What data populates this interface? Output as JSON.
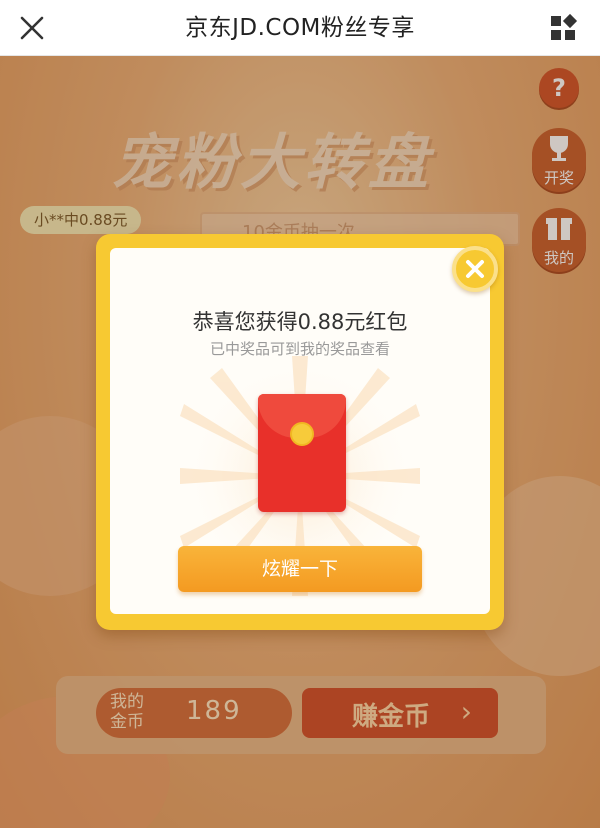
{
  "topbar": {
    "title": "京东JD.COM粉丝专享"
  },
  "event": {
    "banner_title": "宠粉大转盘",
    "ribbon_text": "10金币抽一次",
    "winner_notice": "小**中0.88元",
    "help_symbol": "?",
    "open_label": "开奖",
    "mine_label": "我的",
    "coins_label": "我的金币",
    "coins_value": "189",
    "earn_label": "赚金币",
    "earn_chevron": "›"
  },
  "modal": {
    "title": "恭喜您获得0.88元红包",
    "subtitle": "已中奖品可到我的奖品查看",
    "share_label": "炫耀一下",
    "close_symbol": "×"
  },
  "icons": {
    "close": "close-icon",
    "grid": "grid-menu-icon",
    "trophy": "trophy-icon",
    "gift": "gift-icon",
    "envelope": "red-envelope-icon"
  },
  "colors": {
    "modal_border": "#f7c932",
    "share_button": "#f49a21",
    "envelope": "#e8302a",
    "page_bg": "#ecb078"
  }
}
